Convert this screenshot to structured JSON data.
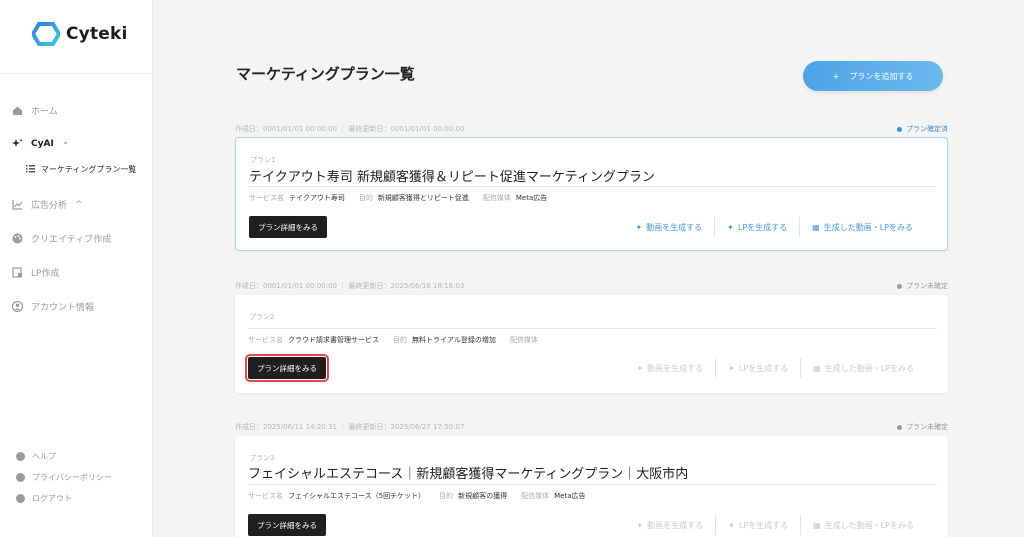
{
  "app": {
    "logo_text": "Cyteki"
  },
  "sidebar": {
    "items": [
      {
        "label": "ホーム",
        "icon": "home-icon"
      },
      {
        "label": "CyAI",
        "icon": "sparkle-icon",
        "chevron": "⌄"
      },
      {
        "label": "広告分析",
        "icon": "chart-icon",
        "chevron": "^"
      },
      {
        "label": "クリエイティブ作成",
        "icon": "palette-icon"
      },
      {
        "label": "LP作成",
        "icon": "lp-icon"
      },
      {
        "label": "アカウント情報",
        "icon": "account-icon"
      }
    ],
    "sub_item": {
      "label": "マーケティングプラン一覧",
      "icon": "list-icon"
    },
    "bottom": [
      {
        "label": "ヘルプ",
        "icon": "help-icon"
      },
      {
        "label": "プライバシーポリシー",
        "icon": "privacy-icon"
      },
      {
        "label": "ログアウト",
        "icon": "logout-icon"
      }
    ]
  },
  "header": {
    "title": "マーケティングプラン一覧",
    "add_button": {
      "plus": "+",
      "label": "プランを追加する"
    }
  },
  "plans": [
    {
      "meta": "作成日：0001/01/01 00:00:00 ｜ 最終更新日：0001/01/01 00:00:00",
      "status": "プラン確定済",
      "label": "プラン1",
      "title": "テイクアウト寿司 新規顧客獲得＆リピート促進マーケティングプラン",
      "service_key": "サービス名",
      "service": "テイクアウト寿司",
      "goal_key": "目的",
      "goal": "新規顧客獲得とリピート促進",
      "media_key": "配信媒体",
      "media": "Meta広告",
      "detail": "プラン詳細をみる",
      "actions": [
        "動画を生成する",
        "LPを生成する",
        "生成した動画・LPをみる"
      ]
    },
    {
      "meta": "作成日：0001/01/01 00:00:00 ｜ 最終更新日：2025/06/16 18:16:03",
      "status": "プラン未確定",
      "label": "プラン2",
      "title": "",
      "service_key": "サービス名",
      "service": "クラウド請求書管理サービス",
      "goal_key": "目的",
      "goal": "無料トライアル登録の増加",
      "media_key": "配信媒体",
      "media": "",
      "detail": "プラン詳細をみる",
      "actions": [
        "動画を生成する",
        "LPを生成する",
        "生成した動画・LPをみる"
      ]
    },
    {
      "meta": "作成日：2025/06/11 14:20:31 ｜ 最終更新日：2025/06/27 17:50:07",
      "status": "プラン未確定",
      "label": "プラン3",
      "title": "フェイシャルエステコース｜新規顧客獲得マーケティングプラン｜大阪市内",
      "service_key": "サービス名",
      "service": "フェイシャルエステコース（5回チケット）",
      "goal_key": "目的",
      "goal": "新規顧客の獲得",
      "media_key": "配信媒体",
      "media": "Meta広告",
      "detail": "プラン詳細をみる",
      "actions": [
        "動画を生成する",
        "LPを生成する",
        "生成した動画・LPをみる"
      ]
    }
  ],
  "colors": {
    "accent": "#4a9ad6",
    "confirmed_dot": "#3b8fd0",
    "unconfirmed_dot": "#9a9a9a",
    "highlight": "#e24b4b"
  }
}
